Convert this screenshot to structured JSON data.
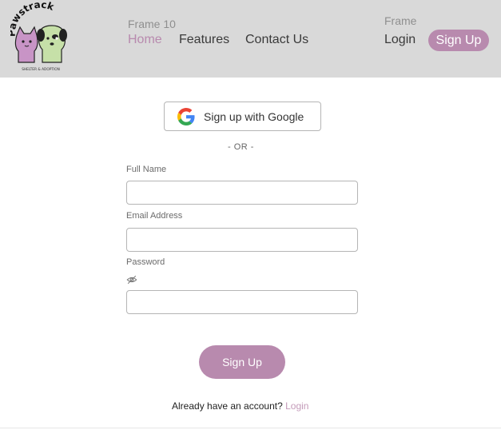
{
  "header": {
    "logo": {
      "brand_text": "Pawstrack",
      "tagline": "SHELTER & ADOPTION"
    },
    "frame_left_label": "Frame 10",
    "frame_right_label": "Frame",
    "nav": {
      "home": "Home",
      "features": "Features",
      "contact": "Contact Us"
    },
    "login_label": "Login",
    "signup_label": "Sign Up"
  },
  "form": {
    "google_button_label": "Sign up with Google",
    "divider_text": "- OR -",
    "full_name": {
      "label": "Full Name",
      "value": "",
      "placeholder": ""
    },
    "email": {
      "label": "Email Address",
      "value": "",
      "placeholder": ""
    },
    "password": {
      "label": "Password",
      "value": "",
      "placeholder": ""
    },
    "submit_label": "Sign Up",
    "footer_prompt": "Already have an account?",
    "footer_link": "Login"
  },
  "colors": {
    "accent": "#b88aae",
    "header_bg": "#d9d9d9",
    "link": "#c49bb9"
  }
}
